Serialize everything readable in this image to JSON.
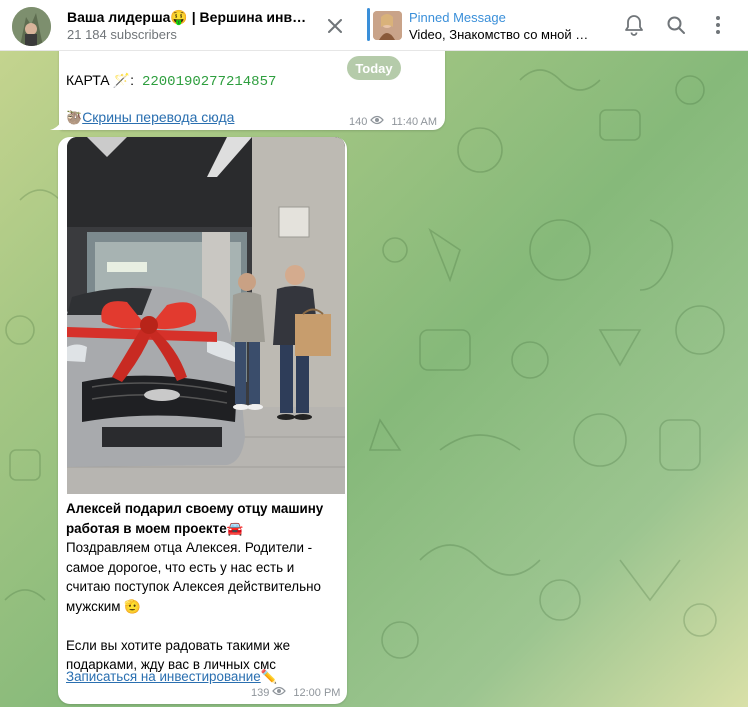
{
  "channel": {
    "title": "Ваша лидерша🤑 | Вершина инв…",
    "subscribers": "21 184 subscribers"
  },
  "pinned": {
    "title": "Pinned Message",
    "text": "Video, Знакомство со мной и…"
  },
  "date_pill": "Today",
  "message1": {
    "card_label": "КАРТА",
    "card_emoji": "🪄",
    "card_number": "2200190277214857",
    "link_emoji": "🦥",
    "link_text": "Скрины перевода сюда",
    "views": "140",
    "time": "11:40 AM"
  },
  "message2": {
    "bold_line": "Алексей подарил своему отцу машину работая в моем проекте🚘",
    "body1": "Поздравляем отца Алексея. Родители - самое дорогое, что есть у нас есть и считаю поступок Алексея действительно мужским 🫡",
    "body2": "Если вы хотите радовать такими же подарками, жду вас в личных смс",
    "link_text": "Записаться на инвестирование",
    "link_emoji": "✏️",
    "views": "139",
    "time": "12:00 PM"
  },
  "icons": {
    "close": "close-icon",
    "bell": "bell-icon",
    "search": "search-icon",
    "more": "more-vertical-icon",
    "eye": "eye-icon"
  },
  "colors": {
    "accent": "#3a8fd9",
    "link": "#2a6fb0",
    "card_number": "#2e9e3e"
  }
}
